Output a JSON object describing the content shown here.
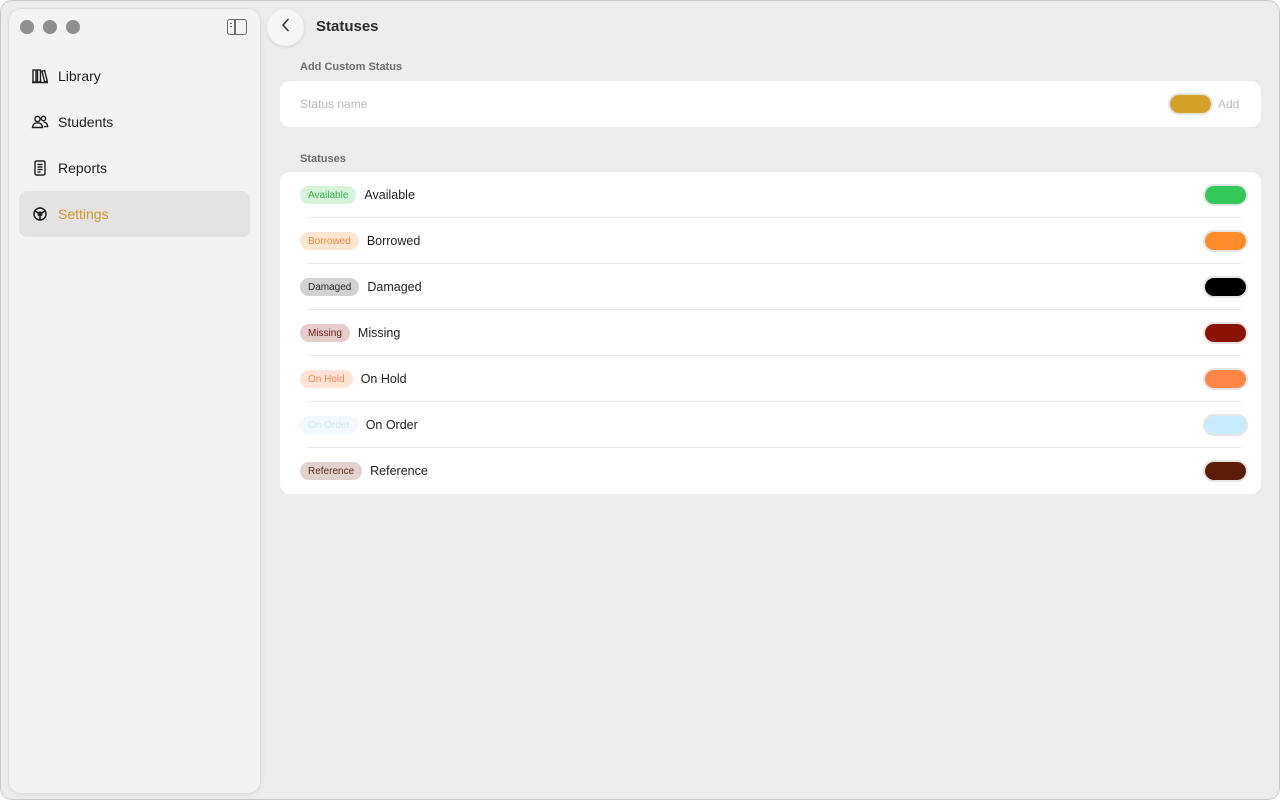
{
  "sidebar": {
    "items": [
      {
        "label": "Library",
        "icon": "books-icon",
        "active": false
      },
      {
        "label": "Students",
        "icon": "people-icon",
        "active": false
      },
      {
        "label": "Reports",
        "icon": "document-icon",
        "active": false
      },
      {
        "label": "Settings",
        "icon": "settings-icon",
        "active": true
      }
    ],
    "active_color": "#d4962a"
  },
  "header": {
    "title": "Statuses"
  },
  "add_section": {
    "label": "Add Custom Status",
    "placeholder": "Status name",
    "value": "",
    "swatch_color": "#d5a027",
    "add_label": "Add"
  },
  "statuses_section": {
    "label": "Statuses",
    "items": [
      {
        "pill": "Available",
        "name": "Available",
        "color": "#34c759",
        "pill_bg": "#d7f3dc",
        "pill_fg": "#37b552"
      },
      {
        "pill": "Borrowed",
        "name": "Borrowed",
        "color": "#ff8c28",
        "pill_bg": "#ffe6d1",
        "pill_fg": "#f0883a"
      },
      {
        "pill": "Damaged",
        "name": "Damaged",
        "color": "#000000",
        "pill_bg": "#d2d2d2",
        "pill_fg": "#2a2a2a"
      },
      {
        "pill": "Missing",
        "name": "Missing",
        "color": "#8b1305",
        "pill_bg": "#e6cdcb",
        "pill_fg": "#6a1c14"
      },
      {
        "pill": "On Hold",
        "name": "On Hold",
        "color": "#ff8548",
        "pill_bg": "#ffe4d6",
        "pill_fg": "#f08a55"
      },
      {
        "pill": "On Order",
        "name": "On Order",
        "color": "#c8ecfd",
        "pill_bg": "#f1f9fe",
        "pill_fg": "#cfe9f6"
      },
      {
        "pill": "Reference",
        "name": "Reference",
        "color": "#5c1c08",
        "pill_bg": "#e2d2cd",
        "pill_fg": "#5a2a1a"
      }
    ]
  }
}
